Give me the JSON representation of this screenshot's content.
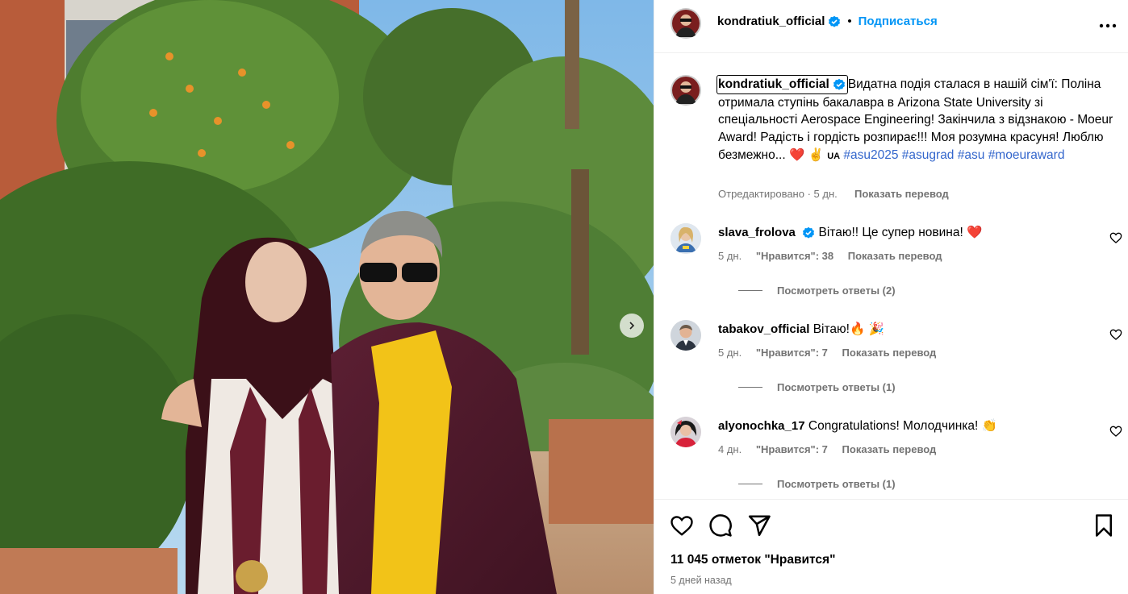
{
  "post": {
    "username": "kondratiuk_official",
    "dot": "•",
    "follow_label": "Подписаться",
    "caption_body": "Видатна подія сталася в нашій сім'ї: Поліна отримала ступінь бакалавра в Arizona State University зі спеціальності Aerospace Engineering! Закінчила з відзнакою - Moeur Award! Радість і гордість розпирає!!! Моя розумна красуня! Люблю безмежно... ❤️ ✌️ ",
    "caption_flag": "UA",
    "hashtags": [
      "#asu2025",
      "#asugrad",
      "#asu",
      "#moeuraward"
    ],
    "edited_label": "Отредактировано",
    "caption_time": "5 дн.",
    "translate_label": "Показать перевод"
  },
  "comments": [
    {
      "username": "slava_frolova",
      "verified": true,
      "text": "Вітаю!! Це супер новина! ❤️",
      "time": "5 дн.",
      "likes": "\"Нравится\": 38",
      "translate": "Показать перевод",
      "replies": "Посмотреть ответы (2)"
    },
    {
      "username": "tabakov_official",
      "verified": false,
      "text": "Вітаю!🔥 🎉",
      "time": "5 дн.",
      "likes": "\"Нравится\": 7",
      "translate": "Показать перевод",
      "replies": "Посмотреть ответы (1)"
    },
    {
      "username": "alyonochka_17",
      "verified": false,
      "text": "Congratulations! Молодчинка! 👏",
      "time": "4 дн.",
      "likes": "\"Нравится\": 7",
      "translate": "Показать перевод",
      "replies": "Посмотреть ответы (1)"
    }
  ],
  "footer": {
    "likes_count": "11 045 отметок \"Нравится\"",
    "date": "5 дней назад"
  },
  "colors": {
    "link_blue": "#0095f6",
    "hashtag": "#3366cc",
    "muted": "#737373",
    "like_red": "#ff3040"
  },
  "icons": {
    "like": "heart-outline-icon",
    "comment": "comment-bubble-icon",
    "share": "paper-plane-icon",
    "save": "bookmark-icon",
    "more": "more-horizontal-icon",
    "next": "chevron-right-icon",
    "verified": "verified-badge-icon"
  }
}
